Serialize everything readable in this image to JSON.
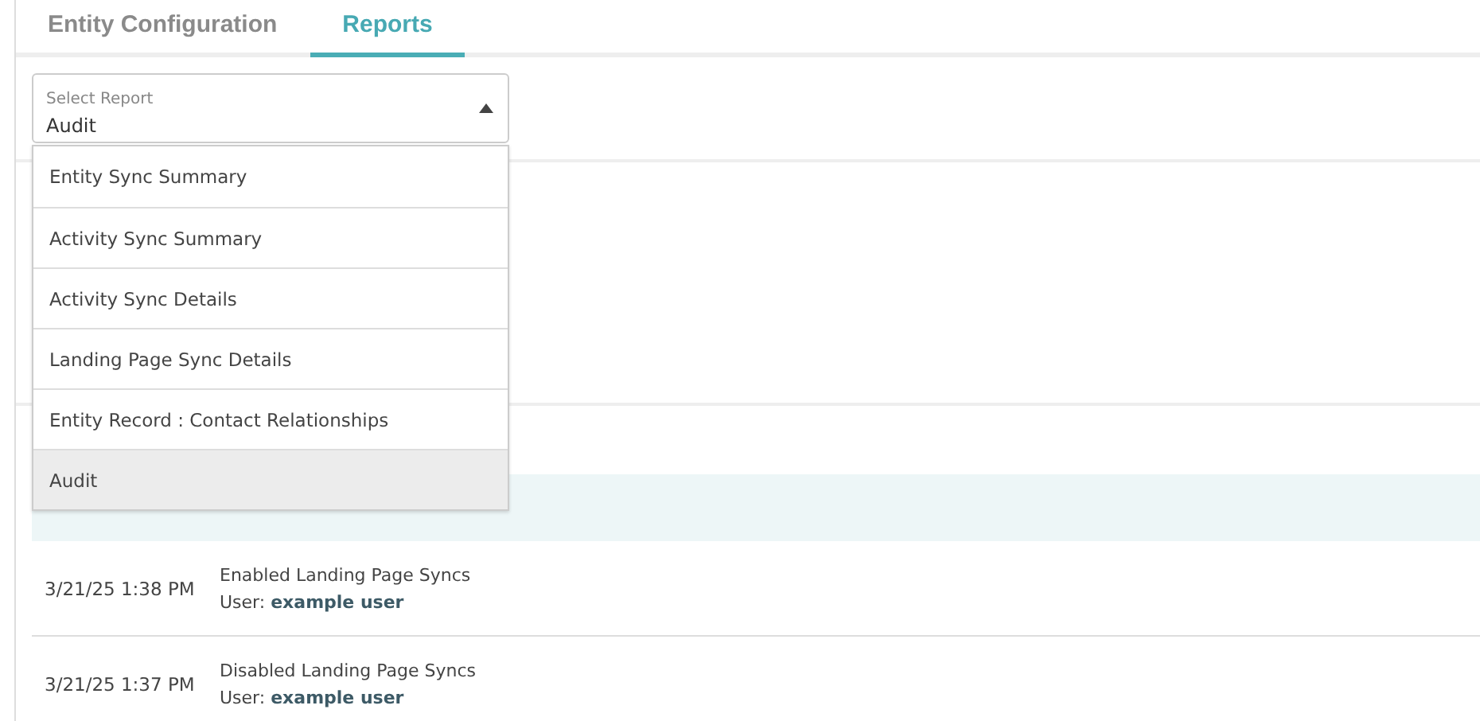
{
  "tabs": [
    {
      "label": "Entity Configuration",
      "selected": false
    },
    {
      "label": "Reports",
      "selected": true
    }
  ],
  "report_select": {
    "label": "Select Report",
    "value": "Audit",
    "expanded": true,
    "options": [
      {
        "label": "Entity Sync Summary",
        "selected": false
      },
      {
        "label": "Activity Sync Summary",
        "selected": false
      },
      {
        "label": "Activity Sync Details",
        "selected": false
      },
      {
        "label": "Landing Page Sync Details",
        "selected": false
      },
      {
        "label": "Entity Record : Contact Relationships",
        "selected": false
      },
      {
        "label": "Audit",
        "selected": true
      }
    ]
  },
  "table": {
    "rows": [
      {
        "date": "3/21/25 1:38 PM",
        "action": "Enabled Landing Page Syncs",
        "user_label": "User:",
        "user": "example user"
      },
      {
        "date": "3/21/25 1:37 PM",
        "action": "Disabled Landing Page Syncs",
        "user_label": "User:",
        "user": "example user"
      }
    ]
  }
}
